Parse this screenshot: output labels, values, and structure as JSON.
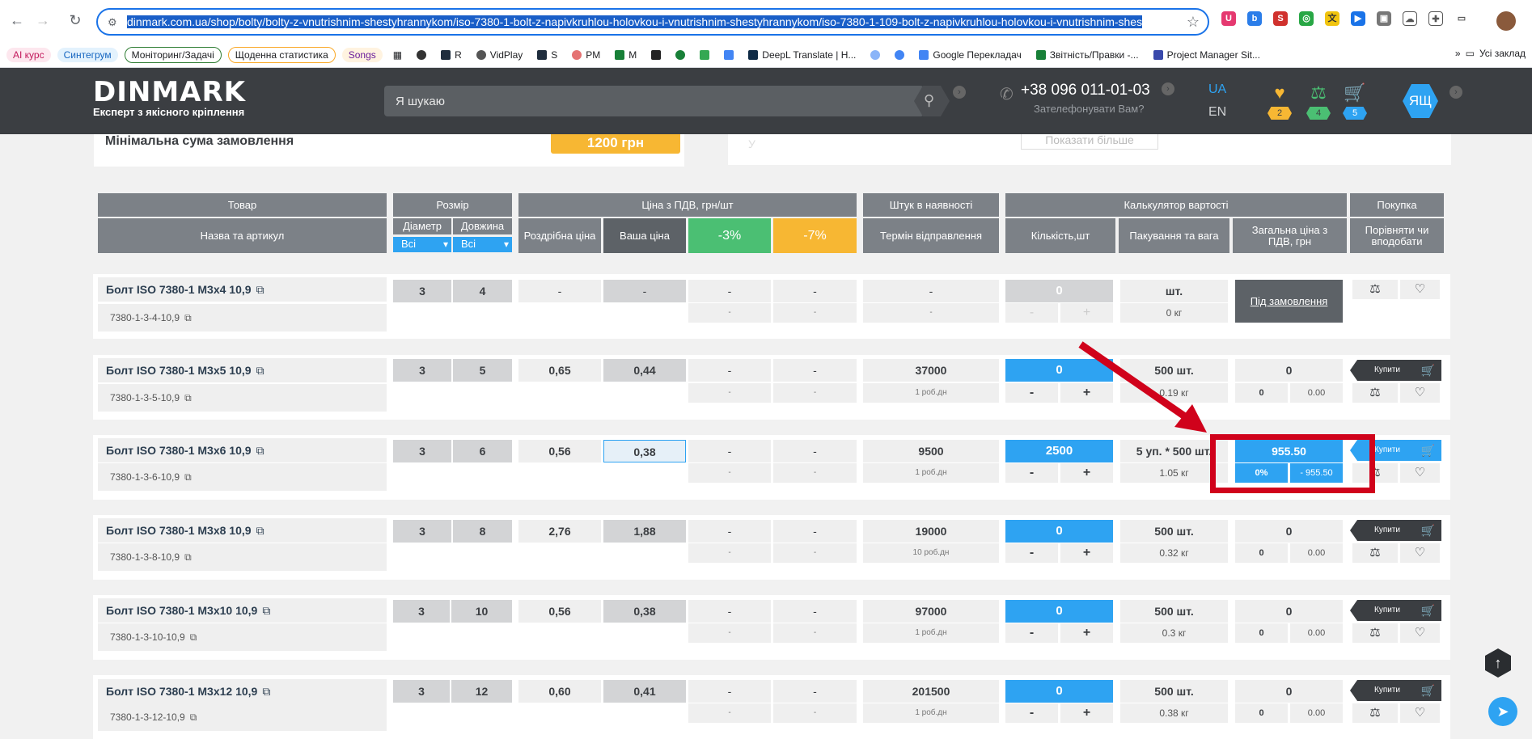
{
  "browser": {
    "url_selected": "dinmark.com.ua/shop/bolty/bolty-z-vnutrishnim-shestyhrannykom/iso-7380-1-bolt-z-napivkruhlou-holovkou-i-vnutrishnim-shestyhrannykom/iso-7380-1-109-bolt-z-napivkruhlou-holovkou-i-vnutrishnim-shes",
    "bookmarks": [
      "AI курс",
      "Синтегрум",
      "Моніторинг/Задачі",
      "Щоденна статистика",
      "Songs",
      "R",
      "VidPlay",
      "S",
      "PM",
      "M",
      "DeepL Translate | H...",
      "Google Перекладач",
      "Звітність/Правки -...",
      "Project Manager Sit..."
    ],
    "bookmarks_all": "Усі заклад"
  },
  "header": {
    "logo_word": "DINMARK",
    "logo_tag": "Експерт з якісного кріплення",
    "search_placeholder": "Я шукаю",
    "phone": "+38 096 011-01-03",
    "callback": "Зателефонувати Вам?",
    "lang_active": "UA",
    "lang_other": "EN",
    "favorites_count": "2",
    "compare_count": "4",
    "cart_count": "5",
    "user_initials": "ЯЩ",
    "colors": {
      "accent": "#2ea3f2",
      "header_bg": "#3b3e42",
      "orange": "#f7b733",
      "green": "#4bbf73"
    }
  },
  "info": {
    "min_sum_label": "Мінімальна сума замовлення",
    "min_sum_value": "1200 грн",
    "show_more": "Показати більше",
    "stray_char": "У"
  },
  "table_headers": {
    "product": "Товар",
    "name_sku": "Назва та артикул",
    "size": "Розмір",
    "diameter": "Діаметр",
    "length": "Довжина",
    "diameter_filter": "Всі",
    "length_filter": "Всі",
    "price_group": "Ціна з ПДВ, грн/шт",
    "retail_price": "Роздрібна ціна",
    "your_price": "Ваша ціна",
    "discount3": "-3%",
    "discount7": "-7%",
    "stock_group": "Штук в наявності",
    "ship_term": "Термін відправлення",
    "calc_group": "Калькулятор вартості",
    "quantity": "Кількість,шт",
    "pack_weight": "Пакування та вага",
    "total_price": "Загальна ціна з ПДВ, грн",
    "purchase": "Покупка",
    "compare_fav": "Порівняти чи вподобати"
  },
  "rows": [
    {
      "name": "Болт ISO 7380-1 M3x4 10,9",
      "sku": "7380-1-3-4-10,9",
      "diameter": "3",
      "length": "4",
      "retail": "-",
      "your": "-",
      "d3": "-",
      "d7": "-",
      "d3_sub": "-",
      "d7_sub": "-",
      "stock": "-",
      "term": "-",
      "qty": "0",
      "minus": "-",
      "plus": "+",
      "pack": "шт.",
      "weight": "0 кг",
      "order_label": "Під замовлення"
    },
    {
      "name": "Болт ISO 7380-1 M3x5 10,9",
      "sku": "7380-1-3-5-10,9",
      "diameter": "3",
      "length": "5",
      "retail": "0,65",
      "your": "0,44",
      "d3": "-",
      "d7": "-",
      "d3_sub": "-",
      "d7_sub": "-",
      "stock": "37000",
      "term": "1 роб.дн",
      "qty": "0",
      "minus": "-",
      "plus": "+",
      "pack": "500 шт.",
      "weight": "0.19 кг",
      "total": "0",
      "disc": "0",
      "disc_total": "0.00",
      "buy": "Купити"
    },
    {
      "name": "Болт ISO 7380-1 M3x6 10,9",
      "sku": "7380-1-3-6-10,9",
      "diameter": "3",
      "length": "6",
      "retail": "0,56",
      "your": "0,38",
      "d3": "-",
      "d7": "-",
      "d3_sub": "-",
      "d7_sub": "-",
      "stock": "9500",
      "term": "1 роб.дн",
      "qty": "2500",
      "minus": "-",
      "plus": "+",
      "pack": "5 уп. * 500 шт.",
      "weight": "1.05 кг",
      "total": "955.50",
      "disc": "0%",
      "disc_total": "- 955.50",
      "buy": "Купити"
    },
    {
      "name": "Болт ISO 7380-1 M3x8 10,9",
      "sku": "7380-1-3-8-10,9",
      "diameter": "3",
      "length": "8",
      "retail": "2,76",
      "your": "1,88",
      "d3": "-",
      "d7": "-",
      "d3_sub": "-",
      "d7_sub": "-",
      "stock": "19000",
      "term": "10 роб.дн",
      "qty": "0",
      "minus": "-",
      "plus": "+",
      "pack": "500 шт.",
      "weight": "0.32 кг",
      "total": "0",
      "disc": "0",
      "disc_total": "0.00",
      "buy": "Купити"
    },
    {
      "name": "Болт ISO 7380-1 M3x10 10,9",
      "sku": "7380-1-3-10-10,9",
      "diameter": "3",
      "length": "10",
      "retail": "0,56",
      "your": "0,38",
      "d3": "-",
      "d7": "-",
      "d3_sub": "-",
      "d7_sub": "-",
      "stock": "97000",
      "term": "1 роб.дн",
      "qty": "0",
      "minus": "-",
      "plus": "+",
      "pack": "500 шт.",
      "weight": "0.3 кг",
      "total": "0",
      "disc": "0",
      "disc_total": "0.00",
      "buy": "Купити"
    },
    {
      "name": "Болт ISO 7380-1 M3x12 10,9",
      "sku": "7380-1-3-12-10,9",
      "diameter": "3",
      "length": "12",
      "retail": "0,60",
      "your": "0,41",
      "d3": "-",
      "d7": "-",
      "d3_sub": "-",
      "d7_sub": "-",
      "stock": "201500",
      "term": "1 роб.дн",
      "qty": "0",
      "minus": "-",
      "plus": "+",
      "pack": "500 шт.",
      "weight": "0.38 кг",
      "total": "0",
      "disc": "0",
      "disc_total": "0.00",
      "buy": "Купити"
    }
  ]
}
